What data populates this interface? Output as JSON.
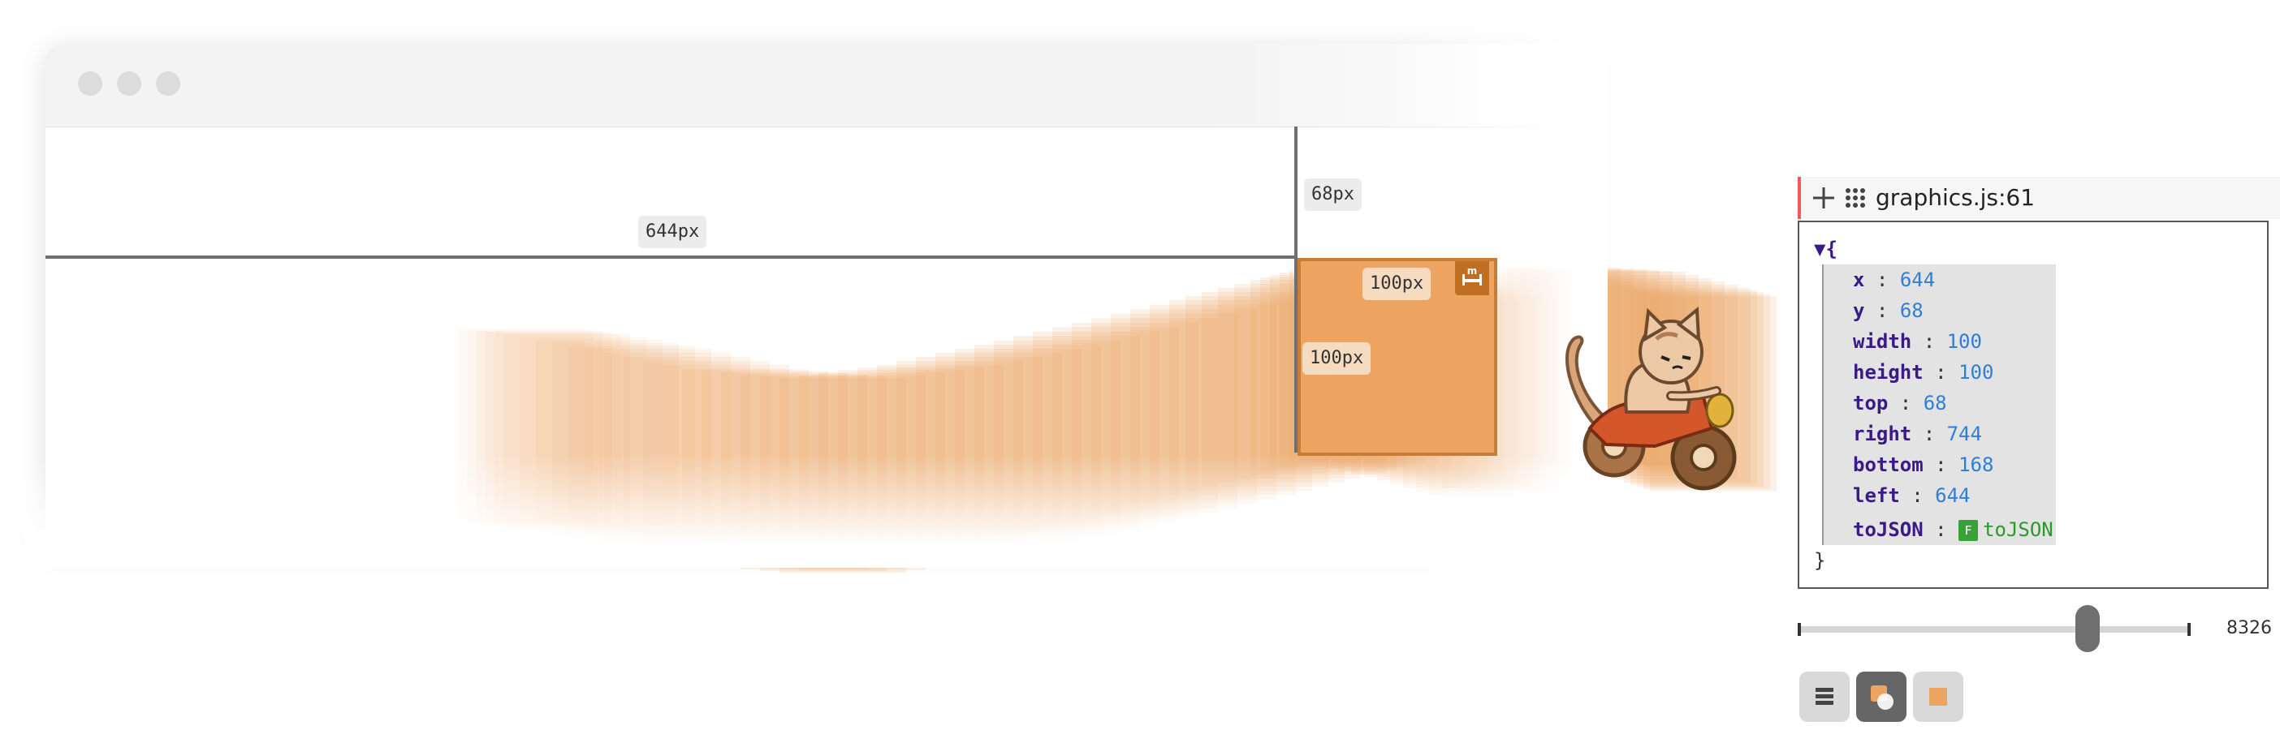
{
  "measures": {
    "left_label": "644px",
    "top_label": "68px",
    "width_label": "100px",
    "height_label": "100px"
  },
  "inspector": {
    "location": "graphics.js:61",
    "open_brace": "▼{",
    "close_brace": "}",
    "props": [
      {
        "key": "x",
        "value": "644"
      },
      {
        "key": "y",
        "value": "68"
      },
      {
        "key": "width",
        "value": "100"
      },
      {
        "key": "height",
        "value": "100"
      },
      {
        "key": "top",
        "value": "68"
      },
      {
        "key": "right",
        "value": "744"
      },
      {
        "key": "bottom",
        "value": "168"
      },
      {
        "key": "left",
        "value": "644"
      }
    ],
    "method": {
      "key": "toJSON",
      "badge": "F",
      "value": "toJSON"
    }
  },
  "timeline": {
    "value": "8326",
    "position": 0.74
  },
  "colors": {
    "trail": "#eda461",
    "box": "#eda461",
    "box_border": "#c77d36",
    "accent_red": "#ef5b5b"
  },
  "icons": {
    "badge": "ruler-icon",
    "panel": [
      "move-icon",
      "drag-grip-icon"
    ],
    "tools": [
      "list-view-icon",
      "shapes-icon",
      "square-icon"
    ]
  }
}
